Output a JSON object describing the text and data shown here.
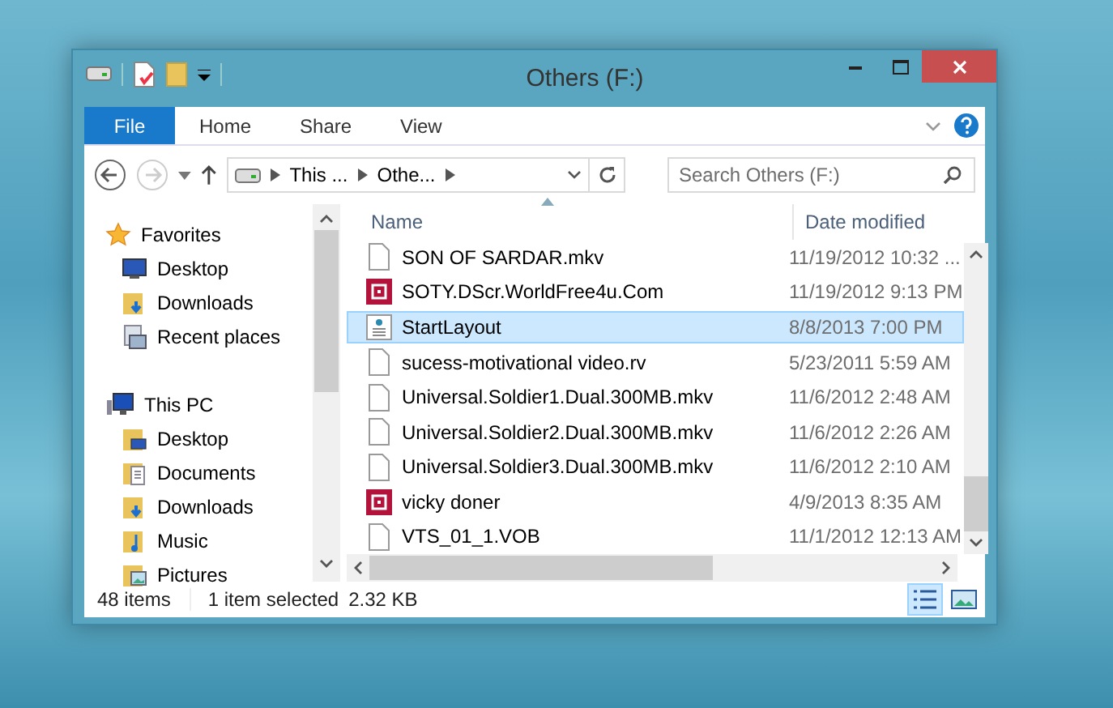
{
  "window": {
    "title": "Others (F:)"
  },
  "ribbon_tabs": [
    {
      "label": "File",
      "kind": "file"
    },
    {
      "label": "Home",
      "kind": "tab"
    },
    {
      "label": "Share",
      "kind": "tab"
    },
    {
      "label": "View",
      "kind": "tab"
    }
  ],
  "address": {
    "segments": [
      "This ...",
      "Othe..."
    ]
  },
  "search": {
    "placeholder": "Search Others (F:)"
  },
  "nav": [
    {
      "label": "Favorites",
      "kind": "star",
      "children": [
        {
          "label": "Desktop",
          "kind": "monitor"
        },
        {
          "label": "Downloads",
          "kind": "download"
        },
        {
          "label": "Recent places",
          "kind": "recent"
        }
      ]
    },
    {
      "label": "This PC",
      "kind": "pc",
      "children": [
        {
          "label": "Desktop",
          "kind": "folder"
        },
        {
          "label": "Documents",
          "kind": "docs"
        },
        {
          "label": "Downloads",
          "kind": "download"
        },
        {
          "label": "Music",
          "kind": "music"
        },
        {
          "label": "Pictures",
          "kind": "pictures"
        }
      ]
    }
  ],
  "columns": [
    {
      "label": "Name",
      "sorted": true
    },
    {
      "label": "Date modified",
      "sorted": false
    }
  ],
  "rows": [
    {
      "name": "SON OF SARDAR.mkv",
      "date": "11/19/2012 10:32 ...",
      "kind": "file",
      "selected": false
    },
    {
      "name": "SOTY.DScr.WorldFree4u.Com",
      "date": "11/19/2012 9:13 PM",
      "kind": "media",
      "selected": false
    },
    {
      "name": "StartLayout",
      "date": "8/8/2013 7:00 PM",
      "kind": "layout",
      "selected": true
    },
    {
      "name": "sucess-motivational video.rv",
      "date": "5/23/2011 5:59 AM",
      "kind": "file",
      "selected": false
    },
    {
      "name": "Universal.Soldier1.Dual.300MB.mkv",
      "date": "11/6/2012 2:48 AM",
      "kind": "file",
      "selected": false
    },
    {
      "name": "Universal.Soldier2.Dual.300MB.mkv",
      "date": "11/6/2012 2:26 AM",
      "kind": "file",
      "selected": false
    },
    {
      "name": "Universal.Soldier3.Dual.300MB.mkv",
      "date": "11/6/2012 2:10 AM",
      "kind": "file",
      "selected": false
    },
    {
      "name": "vicky doner",
      "date": "4/9/2013 8:35 AM",
      "kind": "media",
      "selected": false
    },
    {
      "name": "VTS_01_1.VOB",
      "date": "11/1/2012 12:13 AM",
      "kind": "file",
      "selected": false
    }
  ],
  "status_bar": {
    "count": "48 items",
    "selection": "1 item selected",
    "size": "2.32 KB"
  },
  "views": [
    {
      "kind": "details",
      "selected": true
    },
    {
      "kind": "tiles",
      "selected": false
    }
  ]
}
